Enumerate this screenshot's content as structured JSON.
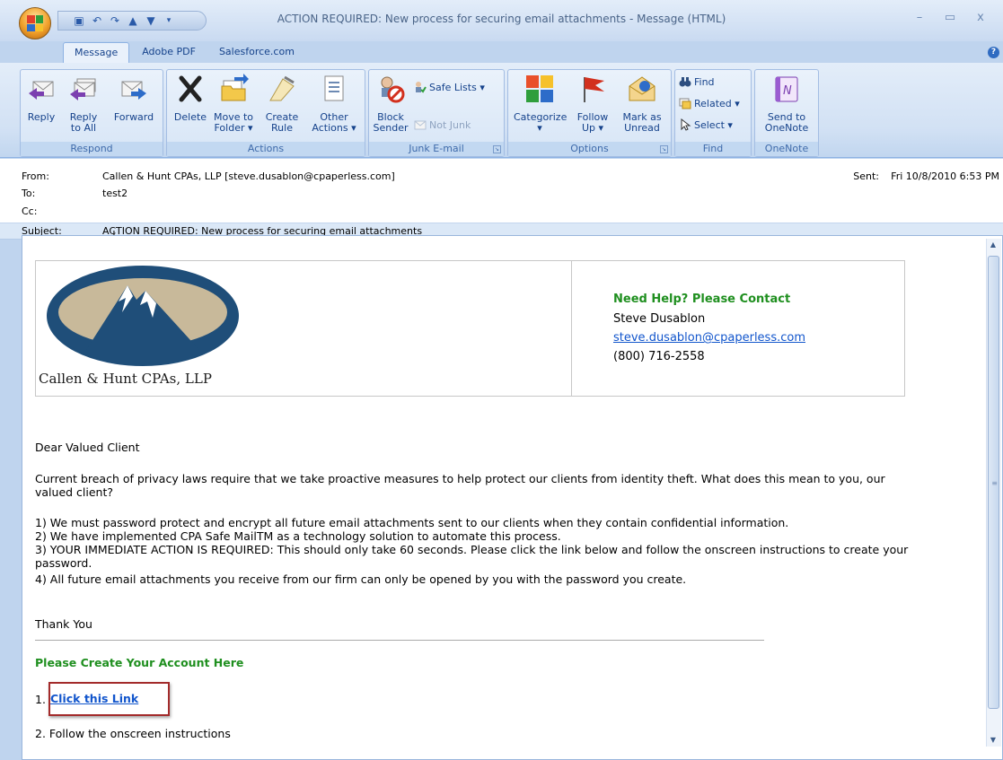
{
  "window": {
    "title": "ACTION REQUIRED: New process for securing email attachments - Message (HTML)"
  },
  "tabs": [
    "Message",
    "Adobe PDF",
    "Salesforce.com"
  ],
  "ribbon": {
    "respond": {
      "label": "Respond",
      "reply": "Reply",
      "reply_all_1": "Reply",
      "reply_all_2": "to All",
      "forward": "Forward"
    },
    "actions": {
      "label": "Actions",
      "delete": "Delete",
      "move_1": "Move to",
      "move_2": "Folder ▾",
      "create_1": "Create",
      "create_2": "Rule",
      "other_1": "Other",
      "other_2": "Actions ▾"
    },
    "junk": {
      "label": "Junk E-mail",
      "block_1": "Block",
      "block_2": "Sender",
      "safe_lists": "Safe Lists ▾",
      "not_junk": "Not Junk"
    },
    "options": {
      "label": "Options",
      "categorize": "Categorize",
      "categorize_2": "▾",
      "follow_1": "Follow",
      "follow_2": "Up ▾",
      "mark_1": "Mark as",
      "mark_2": "Unread"
    },
    "find": {
      "label": "Find",
      "find": "Find",
      "related": "Related ▾",
      "select": "Select ▾"
    },
    "onenote": {
      "label": "OneNote",
      "send_1": "Send to",
      "send_2": "OneNote"
    }
  },
  "header": {
    "from_label": "From:",
    "from": "Callen & Hunt CPAs, LLP [steve.dusablon@cpaperless.com]",
    "to_label": "To:",
    "to": "test2",
    "cc_label": "Cc:",
    "subject_label": "Subject:",
    "subject": "ACTION REQUIRED: New process for securing email attachments",
    "sent_label": "Sent:",
    "sent": "Fri 10/8/2010 6:53 PM"
  },
  "message": {
    "firm_name": "Callen & Hunt CPAs, LLP",
    "help_heading": "Need Help? Please Contact",
    "contact_name": "Steve Dusablon",
    "contact_email": "steve.dusablon@cpaperless.com",
    "contact_phone": "(800) 716-2558",
    "greeting": "Dear Valued Client",
    "intro": "Current breach of privacy laws require that we take proactive measures to help protect our clients from identity theft. What does this mean to you, our valued client?",
    "point1": "1) We must password protect and encrypt all future email attachments sent to our clients when they contain confidential information.",
    "point2": "2) We have implemented CPA Safe MailTM as a technology solution to automate this process.",
    "point3": "3) YOUR IMMEDIATE ACTION IS REQUIRED: This should only take 60 seconds. Please click the link below and follow the onscreen instructions to create your password.",
    "point4": "4) All future email attachments you receive from our firm can only be opened by you with the password you create.",
    "thanks": "Thank You",
    "create_heading": "Please Create Your Account Here",
    "step1_num": "1.",
    "step1_link": "Click this Link",
    "step2": "2. Follow the onscreen instructions"
  },
  "colors": {
    "heading_green": "#1f8f1f",
    "link_blue": "#1155cc",
    "highlight_box": "#a32b2b",
    "logo_navy": "#1f4e79",
    "logo_tan": "#c8b99a"
  }
}
